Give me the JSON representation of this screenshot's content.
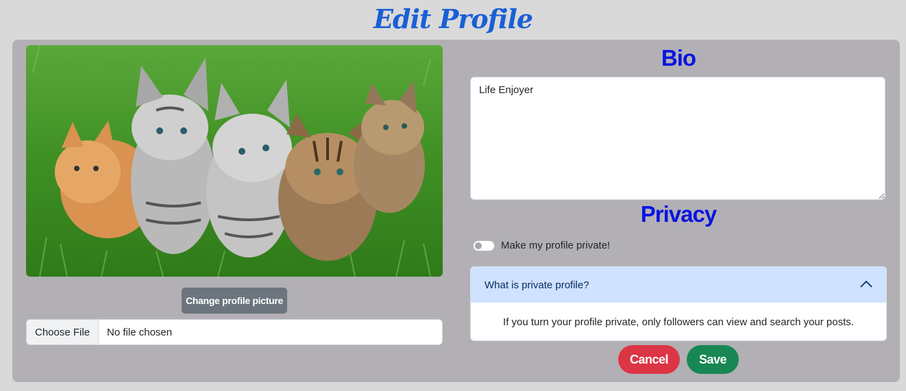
{
  "page": {
    "title": "Edit Profile"
  },
  "profile_picture": {
    "alt": "Profile picture showing five kittens on grass",
    "change_button_label": "Change profile picture",
    "file_input": {
      "button_label": "Choose File",
      "status": "No file chosen"
    }
  },
  "bio": {
    "heading": "Bio",
    "value": "Life Enjoyer"
  },
  "privacy": {
    "heading": "Privacy",
    "toggle_label": "Make my profile private!",
    "toggle_on": false,
    "accordion": {
      "question": "What is private profile?",
      "answer": "If you turn your profile private, only followers can view and search your posts.",
      "expanded": true
    }
  },
  "actions": {
    "cancel_label": "Cancel",
    "save_label": "Save"
  },
  "colors": {
    "title": "#1a5fd6",
    "heading": "#0a14e0",
    "panel": "#b2b0b5",
    "cancel": "#dc3545",
    "save": "#198754",
    "secondary": "#6c757d"
  }
}
